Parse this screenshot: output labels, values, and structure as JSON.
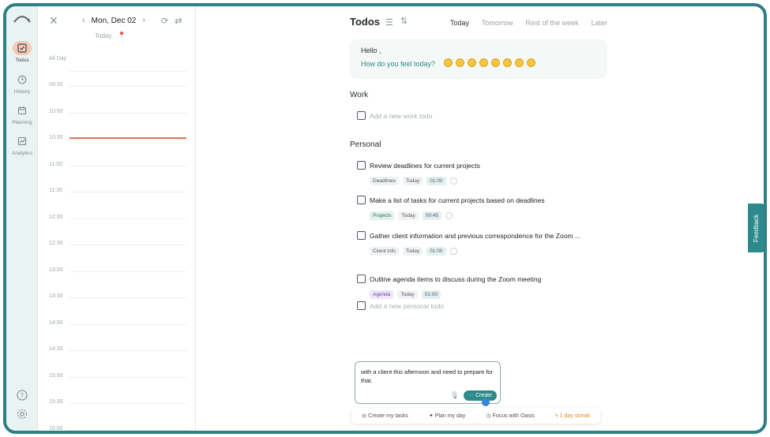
{
  "nav": {
    "items": [
      {
        "label": "Todos",
        "icon": "todos-icon",
        "active": true
      },
      {
        "label": "History",
        "icon": "history-icon",
        "active": false
      },
      {
        "label": "Planning",
        "icon": "planning-icon",
        "active": false
      },
      {
        "label": "Analytics",
        "icon": "analytics-icon",
        "active": false
      }
    ],
    "bottom_icons": [
      "help-icon",
      "settings-icon"
    ]
  },
  "calendar": {
    "date_label": "Mon, Dec 02",
    "today_label": "Today",
    "all_day_label": "All Day",
    "times": [
      "09:30",
      "10:00",
      "10:30",
      "11:00",
      "11:30",
      "12:00",
      "12:30",
      "13:00",
      "13:30",
      "14:00",
      "14:30",
      "15:00",
      "15:30",
      "16:00"
    ]
  },
  "main": {
    "title": "Todos",
    "tabs": [
      "Today",
      "Tomorrow",
      "Rest of the week",
      "Later"
    ],
    "active_tab": "Today",
    "greeting": {
      "hello": "Hello ,",
      "question": "How do you feel today?",
      "emojis": 8
    },
    "work": {
      "heading": "Work",
      "add_placeholder": "Add a new work todo"
    },
    "personal": {
      "heading": "Personal",
      "todos": [
        {
          "text": "Review deadlines for current projects",
          "tags": [
            "Deadlines",
            "Today",
            "01:00"
          ]
        },
        {
          "text": "Make a list of tasks for current projects based on deadlines",
          "tags": [
            "Projects",
            "Today",
            "00:45"
          ]
        },
        {
          "text": "Gather client information and previous correspondence for the Zoom ...",
          "tags": [
            "Client info",
            "Today",
            "01:00"
          ]
        },
        {
          "text": "Outline agenda items to discuss during the Zoom meeting",
          "tags": [
            "Agenda",
            "Today",
            "01:00"
          ]
        }
      ],
      "add_placeholder": "Add a new personal todo"
    },
    "composer": {
      "text": "with a client this afternoon and need to prepare for that.",
      "create_label": "Create"
    },
    "bottom_bar": {
      "create_tasks": "Create my tasks",
      "plan_day": "Plan my day",
      "focus": "Focus with Oasis",
      "streak": "1 day streak"
    },
    "feedback_label": "Feedback"
  },
  "colors": {
    "accent": "#2e7f86",
    "now_line": "#e8745a"
  }
}
